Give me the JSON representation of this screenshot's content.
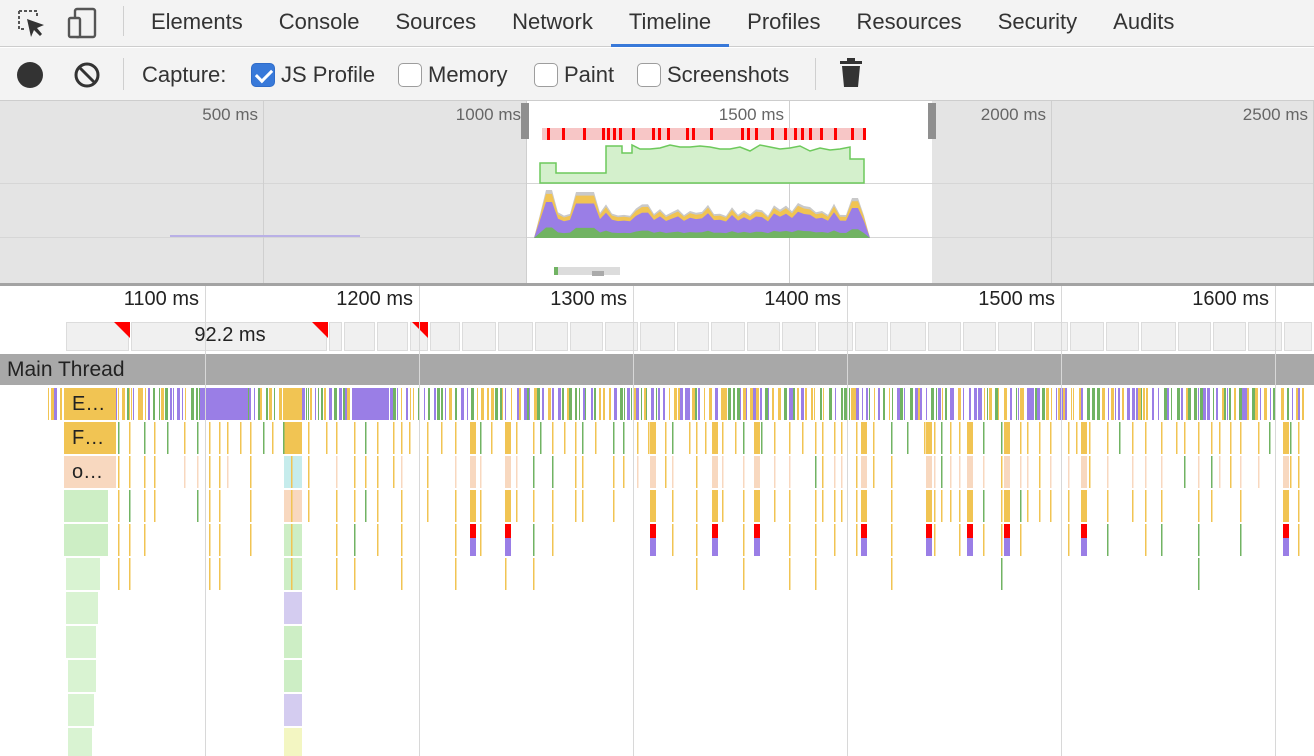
{
  "tabs": [
    {
      "label": "Elements"
    },
    {
      "label": "Console"
    },
    {
      "label": "Sources"
    },
    {
      "label": "Network"
    },
    {
      "label": "Timeline",
      "active": true
    },
    {
      "label": "Profiles"
    },
    {
      "label": "Resources"
    },
    {
      "label": "Security"
    },
    {
      "label": "Audits"
    }
  ],
  "toolbar": {
    "capture_label": "Capture:",
    "options": [
      {
        "label": "JS Profile",
        "checked": true
      },
      {
        "label": "Memory",
        "checked": false
      },
      {
        "label": "Paint",
        "checked": false
      },
      {
        "label": "Screenshots",
        "checked": false
      }
    ]
  },
  "overview": {
    "tick_labels": [
      "500 ms",
      "1000 ms",
      "1500 ms",
      "2000 ms",
      "2500 ms"
    ]
  },
  "ruler": {
    "tick_labels": [
      "1100 ms",
      "1200 ms",
      "1300 ms",
      "1400 ms",
      "1500 ms",
      "1600 ms"
    ]
  },
  "frames": {
    "selected_duration": "92.2 ms"
  },
  "main_thread": {
    "title": "Main Thread",
    "labels": [
      "E…",
      "F…",
      "o…"
    ]
  },
  "colors": {
    "accent": "#3879d9",
    "scripting": "#f1c453",
    "rendering": "#9a7ee6",
    "painting": "#71b363",
    "fps_fill": "#d4f0cc",
    "fps_line": "#6dc95c",
    "red_flag": "#ff0000"
  },
  "icons": [
    "inspect-element-icon",
    "device-mode-icon",
    "record-icon",
    "clear-icon",
    "trash-icon"
  ]
}
